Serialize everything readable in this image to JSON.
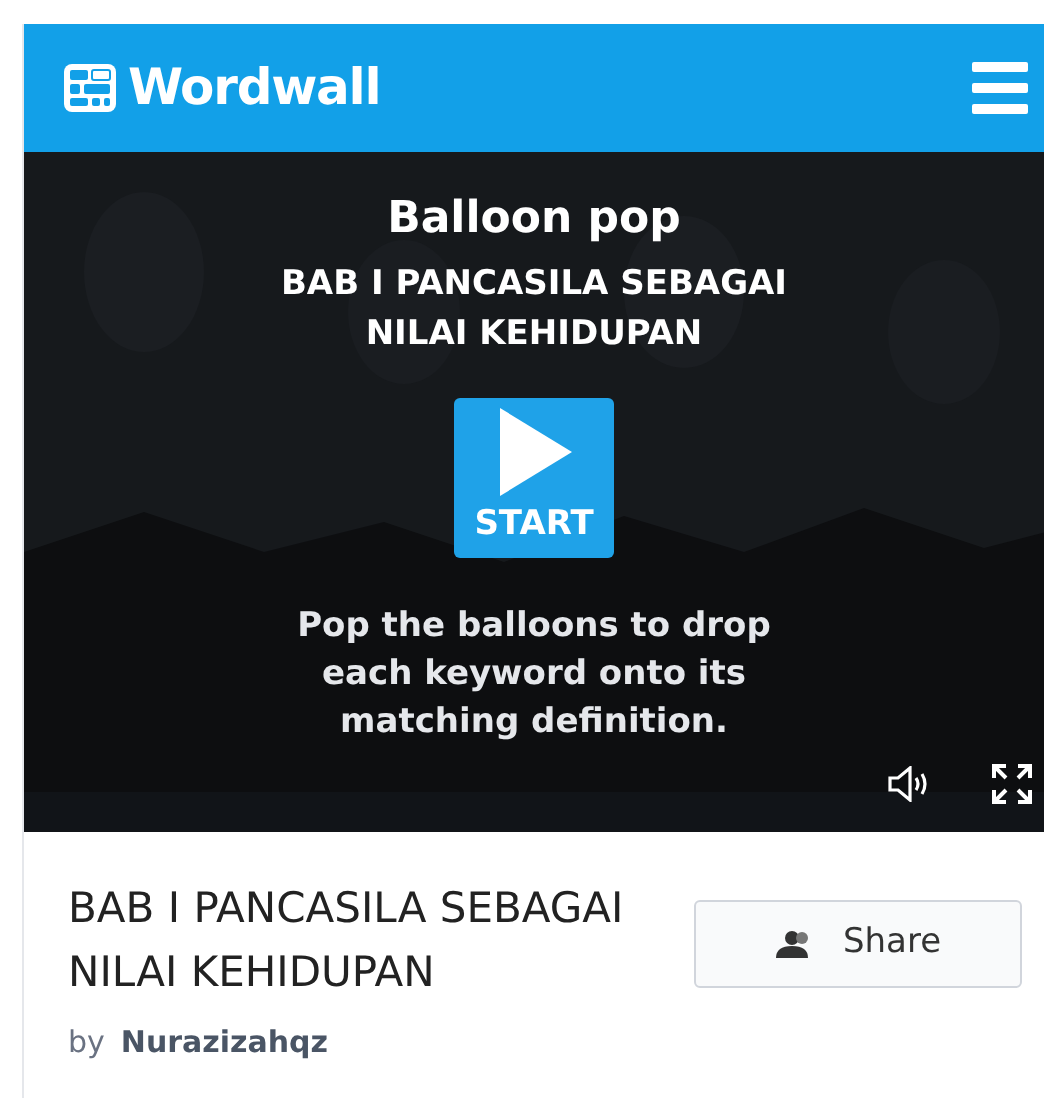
{
  "header": {
    "logo_text": "Wordwall"
  },
  "game": {
    "title": "Balloon pop",
    "subtitle": "BAB I PANCASILA SEBAGAI NILAI KEHIDUPAN",
    "start_label": "START",
    "instructions": "Pop the balloons to drop each keyword onto its matching definition."
  },
  "activity": {
    "title": "BAB I PANCASILA SEBAGAI NILAI KEHIDUPAN",
    "by_label": "by",
    "author": "Nurazizahqz",
    "share_label": "Share"
  }
}
